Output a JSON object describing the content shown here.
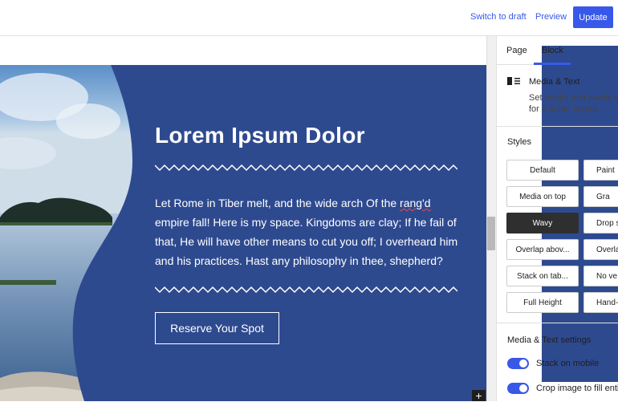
{
  "header": {
    "switch_to_draft": "Switch to draft",
    "preview": "Preview",
    "update": "Update"
  },
  "content": {
    "headline": "Lorem Ipsum Dolor",
    "body_before": "Let Rome in Tiber melt, and the wide arch Of the ",
    "body_misspelled": "rang'd",
    "body_after": " empire fall! Here is my space. Kingdoms are clay; If he fail of that, He will have other means to cut you off; I overheard him and his practices. Hast any philosophy in thee, shepherd?",
    "cta": "Reserve Your Spot",
    "background_color": "#2e4a8f"
  },
  "editor": {
    "inserter_symbol": "+"
  },
  "sidebar": {
    "tabs": [
      "Page",
      "Block"
    ],
    "active_tab": "Block",
    "block": {
      "icon": "media-text-icon",
      "name": "Media & Text",
      "desc_line1": "Set media and words side",
      "desc_line2": "for a richer layout."
    },
    "styles_title": "Styles",
    "styles": [
      {
        "label": "Default"
      },
      {
        "label": "Paint"
      },
      {
        "label": "Media on top"
      },
      {
        "label": "Gra"
      },
      {
        "label": "Wavy",
        "active": true
      },
      {
        "label": "Drop s"
      },
      {
        "label": "Overlap abov..."
      },
      {
        "label": "Overla"
      },
      {
        "label": "Stack on tab..."
      },
      {
        "label": "No ve"
      },
      {
        "label": "Full Height"
      },
      {
        "label": "Hand-D"
      }
    ],
    "settings_title": "Media & Text settings",
    "toggles": [
      {
        "label": "Stack on mobile",
        "on": true
      },
      {
        "label": "Crop image to fill entire",
        "on": true
      }
    ],
    "accent_color": "#3858e9"
  }
}
